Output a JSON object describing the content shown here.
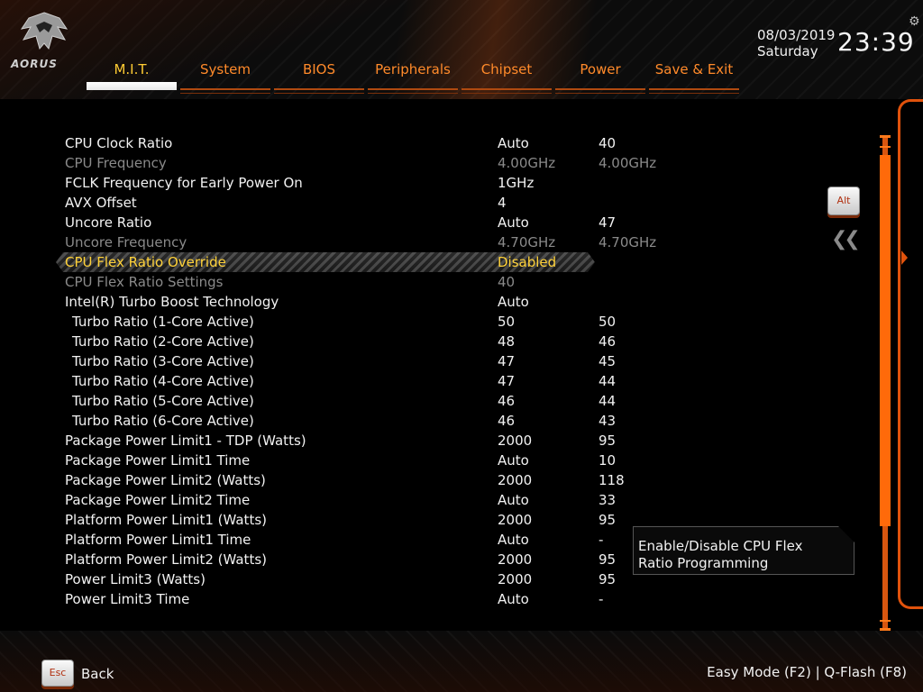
{
  "header": {
    "logo_text": "AORUS",
    "date": "08/03/2019",
    "weekday": "Saturday",
    "time": "23:39",
    "tabs": [
      {
        "label": "M.I.T.",
        "active": true
      },
      {
        "label": "System"
      },
      {
        "label": "BIOS"
      },
      {
        "label": "Peripherals"
      },
      {
        "label": "Chipset"
      },
      {
        "label": "Power"
      },
      {
        "label": "Save & Exit"
      }
    ]
  },
  "settings": [
    {
      "label": "CPU Clock Ratio",
      "v1": "Auto",
      "v2": "40"
    },
    {
      "label": "CPU Frequency",
      "v1": "4.00GHz",
      "v2": "4.00GHz",
      "dim": true
    },
    {
      "label": "FCLK Frequency for Early Power On",
      "v1": "1GHz",
      "v2": ""
    },
    {
      "label": "AVX Offset",
      "v1": "4",
      "v2": ""
    },
    {
      "label": "Uncore Ratio",
      "v1": "Auto",
      "v2": "47"
    },
    {
      "label": "Uncore Frequency",
      "v1": "4.70GHz",
      "v2": "4.70GHz",
      "dim": true
    },
    {
      "label": "CPU Flex Ratio Override",
      "v1": "Disabled",
      "v2": "",
      "selected": true
    },
    {
      "label": "CPU Flex Ratio Settings",
      "v1": "40",
      "v2": "",
      "dim": true
    },
    {
      "label": "Intel(R) Turbo Boost Technology",
      "v1": "Auto",
      "v2": ""
    },
    {
      "label": "Turbo Ratio (1-Core Active)",
      "v1": "50",
      "v2": "50",
      "sub": true
    },
    {
      "label": "Turbo Ratio (2-Core Active)",
      "v1": "48",
      "v2": "46",
      "sub": true
    },
    {
      "label": "Turbo Ratio (3-Core Active)",
      "v1": "47",
      "v2": "45",
      "sub": true
    },
    {
      "label": "Turbo Ratio (4-Core Active)",
      "v1": "47",
      "v2": "44",
      "sub": true
    },
    {
      "label": "Turbo Ratio (5-Core Active)",
      "v1": "46",
      "v2": "44",
      "sub": true
    },
    {
      "label": "Turbo Ratio (6-Core Active)",
      "v1": "46",
      "v2": "43",
      "sub": true
    },
    {
      "label": "Package Power Limit1 - TDP (Watts)",
      "v1": "2000",
      "v2": "95"
    },
    {
      "label": "Package Power Limit1 Time",
      "v1": "Auto",
      "v2": "10"
    },
    {
      "label": "Package Power Limit2 (Watts)",
      "v1": "2000",
      "v2": "118"
    },
    {
      "label": "Package Power Limit2 Time",
      "v1": "Auto",
      "v2": "33"
    },
    {
      "label": "Platform Power Limit1 (Watts)",
      "v1": "2000",
      "v2": "95"
    },
    {
      "label": "Platform Power Limit1 Time",
      "v1": "Auto",
      "v2": "-"
    },
    {
      "label": "Platform Power Limit2 (Watts)",
      "v1": "2000",
      "v2": "95"
    },
    {
      "label": "Power Limit3 (Watts)",
      "v1": "2000",
      "v2": "95"
    },
    {
      "label": "Power Limit3 Time",
      "v1": "Auto",
      "v2": "-"
    }
  ],
  "help": {
    "line1": "Enable/Disable CPU Flex",
    "line2": "Ratio Programming"
  },
  "keys": {
    "alt": "Alt",
    "esc": "Esc"
  },
  "footer": {
    "back_label": "Back",
    "hint": "Easy Mode (F2)  |  Q-Flash (F8)"
  },
  "colors": {
    "accent": "#ff6a0a",
    "tab_text": "#ff8a2a",
    "active_tab_text": "#ffcc33",
    "selected_row_text": "#ffd23a",
    "dim_text": "#8a8a8a"
  }
}
